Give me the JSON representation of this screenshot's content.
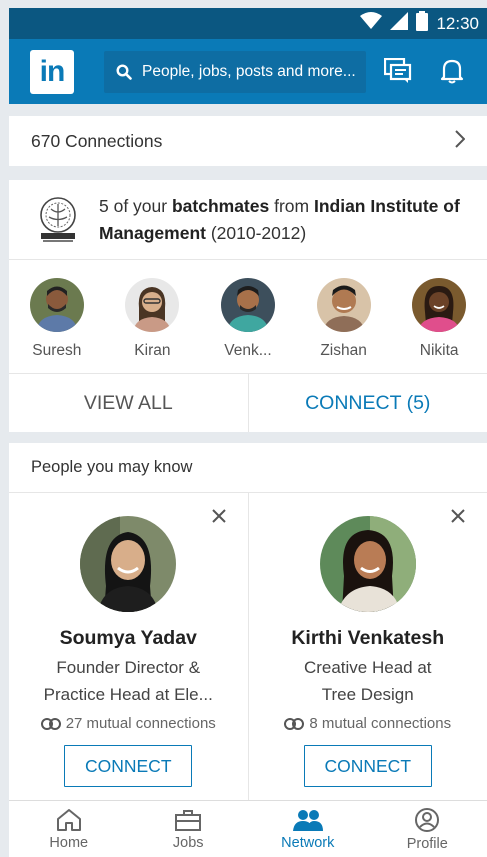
{
  "status": {
    "time": "12:30"
  },
  "search": {
    "placeholder": "People, jobs, posts and more..."
  },
  "connections": {
    "label": "670 Connections"
  },
  "batchmates": {
    "prefix": "5 of your ",
    "bold1": "batchmates",
    "mid": " from ",
    "bold2": "Indian Institute of Management",
    "suffix": " (2010-2012)",
    "people": [
      {
        "name": "Suresh"
      },
      {
        "name": "Kiran"
      },
      {
        "name": "Venk..."
      },
      {
        "name": "Zishan"
      },
      {
        "name": "Nikita"
      }
    ],
    "view_all_label": "VIEW ALL",
    "connect_all_label": "CONNECT (5)"
  },
  "pymk": {
    "title": "People you may know",
    "cards": [
      {
        "name": "Soumya Yadav",
        "headline_line1": "Founder Director &",
        "headline_line2": "Practice Head at Ele...",
        "mutual": "27 mutual connections",
        "connect_label": "CONNECT"
      },
      {
        "name": "Kirthi Venkatesh",
        "headline_line1": "Creative Head at",
        "headline_line2": "Tree Design",
        "mutual": "8 mutual connections",
        "connect_label": "CONNECT"
      }
    ]
  },
  "nav": [
    {
      "label": "Home",
      "icon": "home-icon"
    },
    {
      "label": "Jobs",
      "icon": "briefcase-icon"
    },
    {
      "label": "Network",
      "icon": "people-icon"
    },
    {
      "label": "Profile",
      "icon": "profile-icon"
    }
  ],
  "colors": {
    "brand": "#0a7ab7",
    "statusbar": "#0b5781"
  }
}
